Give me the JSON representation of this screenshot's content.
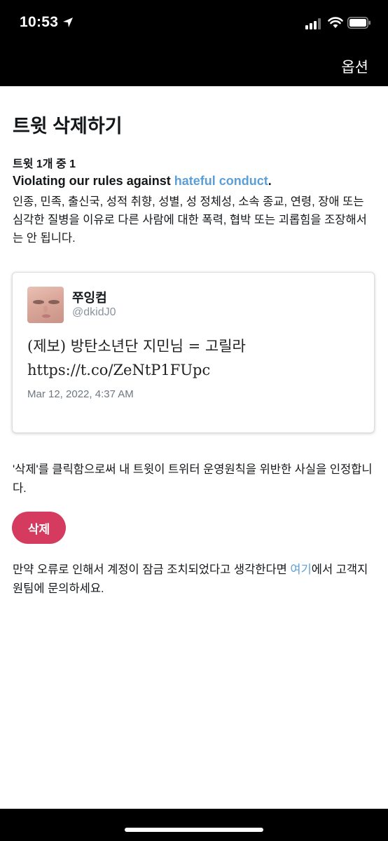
{
  "status_bar": {
    "time": "10:53"
  },
  "nav": {
    "options_label": "옵션"
  },
  "page": {
    "title": "트윗 삭제하기",
    "tweet_count": "트윗 1개 중 1",
    "violation": {
      "prefix": "Violating our rules against ",
      "link_text": "hateful conduct",
      "suffix": ".",
      "description": "인종, 민족, 출신국, 성적 취향, 성별, 성 정체성, 소속 종교, 연령, 장애 또는 심각한 질병을 이유로 다른 사람에 대한 폭력, 협박 또는 괴롭힘을 조장해서는 안 됩니다."
    }
  },
  "tweet": {
    "author_name": "쭈잉컴",
    "author_handle": "@dkidJ0",
    "text_line1": "(제보) 방탄소년단 지민님 = 고릴라",
    "text_line2": "https://t.co/ZeNtP1FUpc",
    "date": "Mar 12, 2022, 4:37 AM"
  },
  "consent_text": "'삭제'를 클릭함으로써 내 트윗이 트위터 운영원칙을 위반한 사실을 인정합니다.",
  "delete_button_label": "삭제",
  "appeal": {
    "prefix": "만약 오류로 인해서 계정이 잠금 조치되었다고 생각한다면 ",
    "link_text": "여기",
    "suffix": "에서 고객지원팀에 문의하세요."
  },
  "colors": {
    "accent_link": "#5b9fd6",
    "delete_button": "#d43b5e",
    "top_bar": "#000000"
  }
}
